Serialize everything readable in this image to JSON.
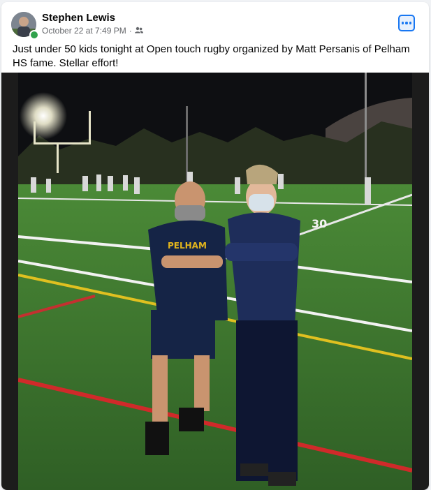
{
  "post": {
    "author": "Stephen Lewis",
    "timestamp": "October 22 at 7:49 PM",
    "separator": "·",
    "audience_icon": "friends-icon",
    "more_icon": "more-options-icon",
    "text": "Just under 50 kids tonight at Open touch rugby organized by Matt Persanis of Pelham HS fame. Stellar effort!"
  },
  "photo": {
    "jersey_text": "PELHAM",
    "field_number": "30"
  },
  "colors": {
    "accent": "#1877f2",
    "online": "#31a24c",
    "secondary_text": "#65676b",
    "field_green": "#3f7a2e"
  }
}
